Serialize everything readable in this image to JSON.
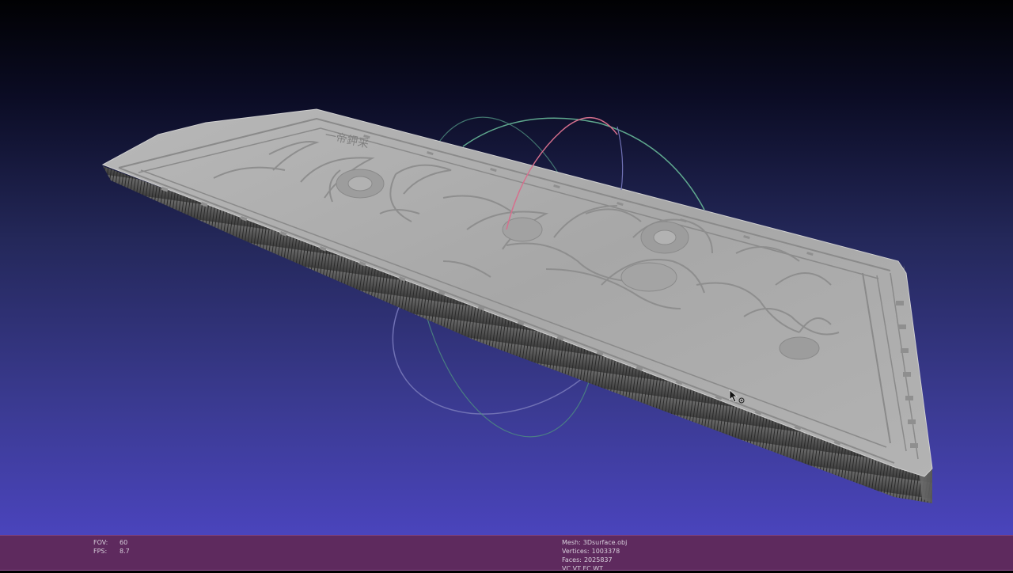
{
  "viewer": {
    "background_top": "#010103",
    "background_bottom": "#4a44bc",
    "status_bar_color": "#5e2a5e",
    "trackball_colors": {
      "red": "#d66f8d",
      "green": "#5fa88e",
      "blue": "#6e6fb2"
    }
  },
  "model": {
    "description_icon": "carved-relief-panel-mesh",
    "inscription": "一帝鉀采"
  },
  "status": {
    "left": [
      {
        "key": "FOV:",
        "value": "60"
      },
      {
        "key": "FPS:",
        "value": "8.7"
      }
    ],
    "right": [
      {
        "key": "Mesh:",
        "value": "3Dsurface.obj"
      },
      {
        "key": "Vertices:",
        "value": "1003378"
      },
      {
        "key": "Faces:",
        "value": "2025837"
      },
      {
        "key": "VC VT FC WT",
        "value": ""
      }
    ]
  }
}
